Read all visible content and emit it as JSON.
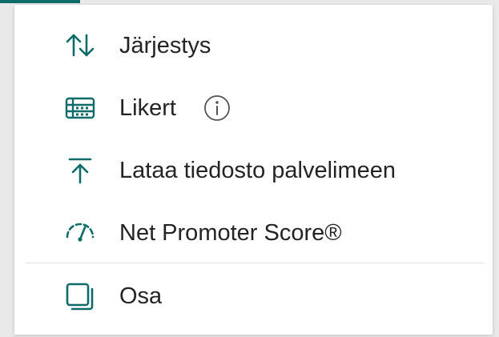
{
  "menu": {
    "items": [
      {
        "label": "Järjestys",
        "icon": "sort-arrows-icon"
      },
      {
        "label": "Likert",
        "icon": "likert-grid-icon",
        "info_icon": "info-icon"
      },
      {
        "label": "Lataa tiedosto palvelimeen",
        "icon": "upload-icon"
      },
      {
        "label": "Net Promoter Score®",
        "icon": "gauge-icon"
      },
      {
        "label": "Osa",
        "icon": "section-icon"
      }
    ]
  },
  "colors": {
    "accent": "#0e6b68",
    "text": "#242424",
    "divider": "#e2e2e2"
  }
}
